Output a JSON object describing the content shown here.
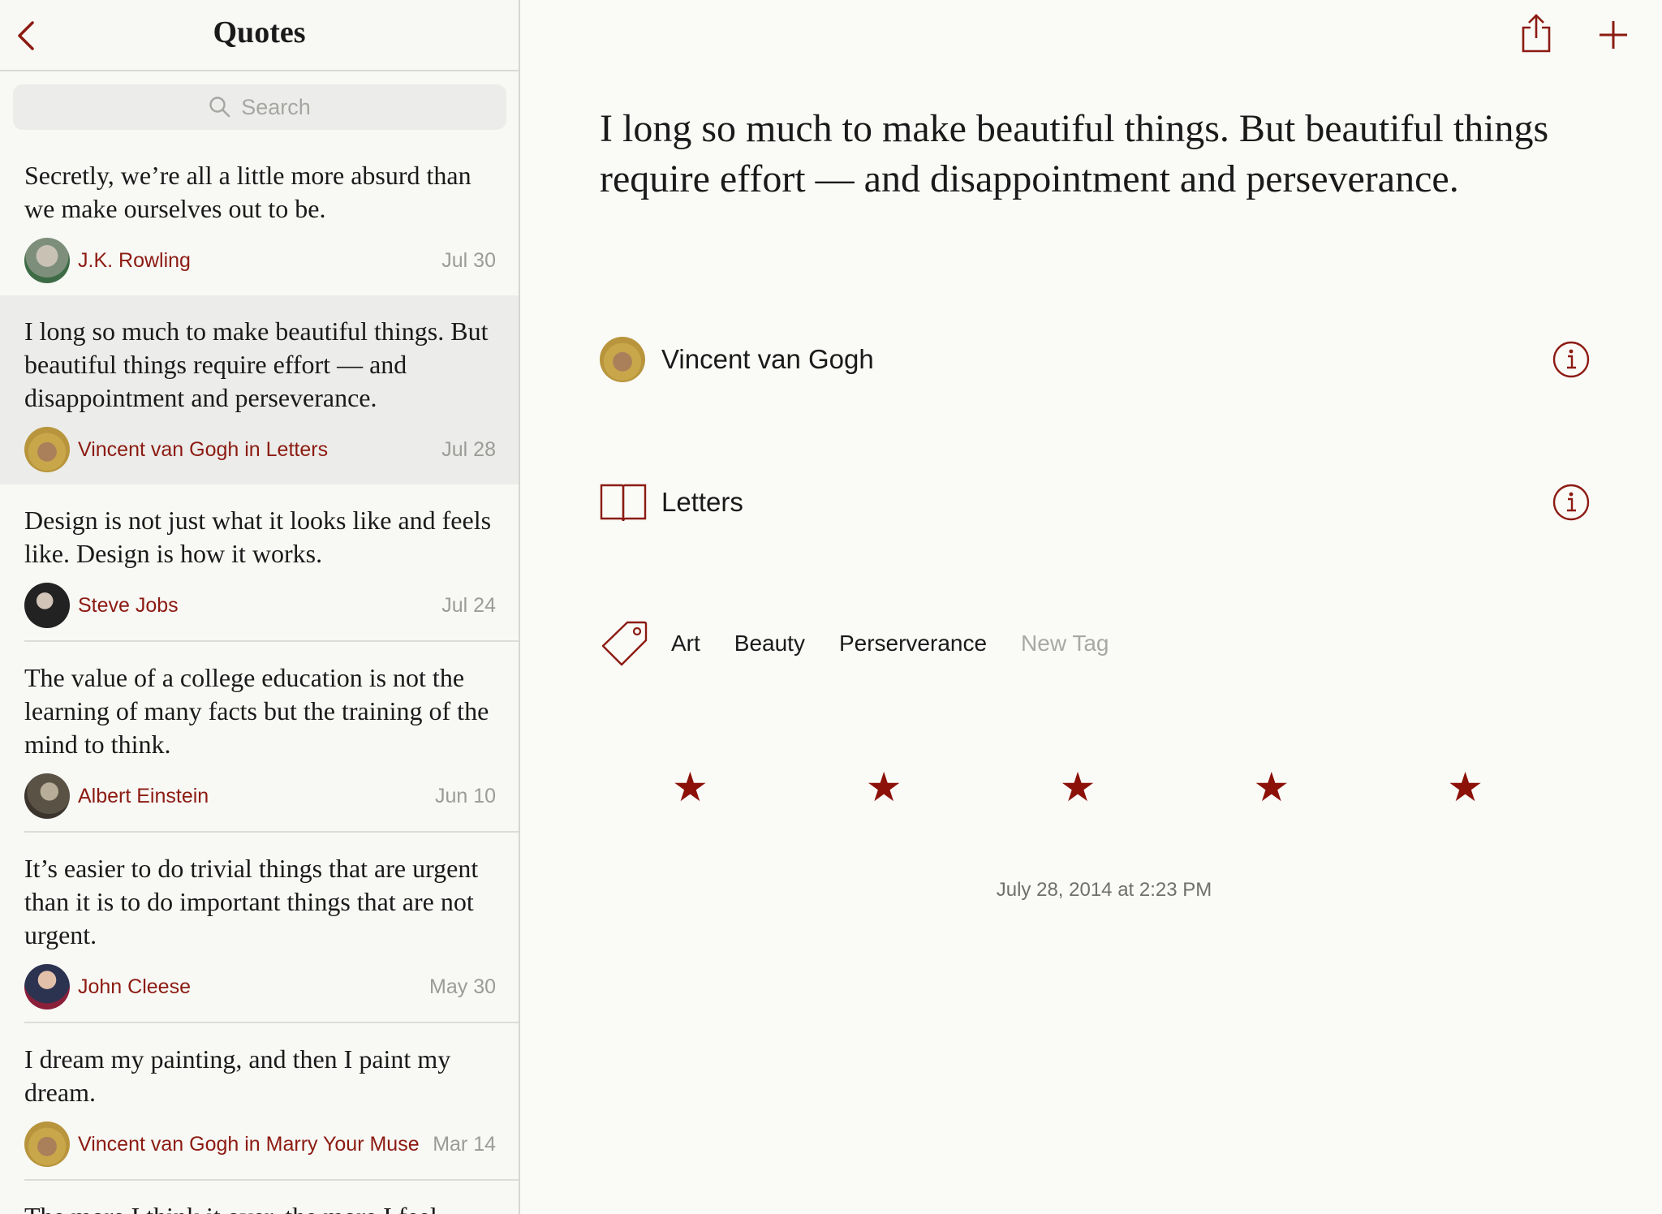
{
  "sidebar": {
    "title": "Quotes",
    "search_placeholder": "Search",
    "items": [
      {
        "quote": "Secretly, we’re all a little more absurd than we make ourselves out to be.",
        "author": "J.K. Rowling",
        "date": "Jul 30"
      },
      {
        "quote": "I long so much to make beautiful things. But beautiful things require effort — and disappointment and perseverance.",
        "author": "Vincent van Gogh in Letters",
        "date": "Jul 28"
      },
      {
        "quote": "Design is not just what it looks like and feels like. Design is how it works.",
        "author": "Steve Jobs",
        "date": "Jul 24"
      },
      {
        "quote": "The value of a college education is not the learning of many facts but the training of the mind to think.",
        "author": "Albert Einstein",
        "date": "Jun 10"
      },
      {
        "quote": "It’s easier to do trivial things that are urgent than it is to do important things that are not urgent.",
        "author": "John Cleese",
        "date": "May 30"
      },
      {
        "quote": "I dream my painting, and then I paint my dream.",
        "author": "Vincent van Gogh in Marry Your Muse",
        "date": "Mar 14"
      },
      {
        "quote": "The more I think it over, the more I feel",
        "author": "",
        "date": ""
      }
    ]
  },
  "detail": {
    "quote": "I long so much to make beautiful things. But beautiful things require effort — and disappointment and perseverance.",
    "author": "Vincent van Gogh",
    "source": "Letters",
    "tags": [
      "Art",
      "Beauty",
      "Perserverance"
    ],
    "new_tag_label": "New Tag",
    "rating": 5,
    "star_glyph": "★",
    "timestamp": "July 28, 2014 at 2:23 PM"
  },
  "colors": {
    "accent": "#8c1b12",
    "star": "#8c1109",
    "selected_row": "#ececea"
  },
  "icons": [
    "back-chevron-icon",
    "search-icon",
    "share-icon",
    "plus-icon",
    "info-icon",
    "book-icon",
    "tag-icon",
    "star-icon"
  ]
}
